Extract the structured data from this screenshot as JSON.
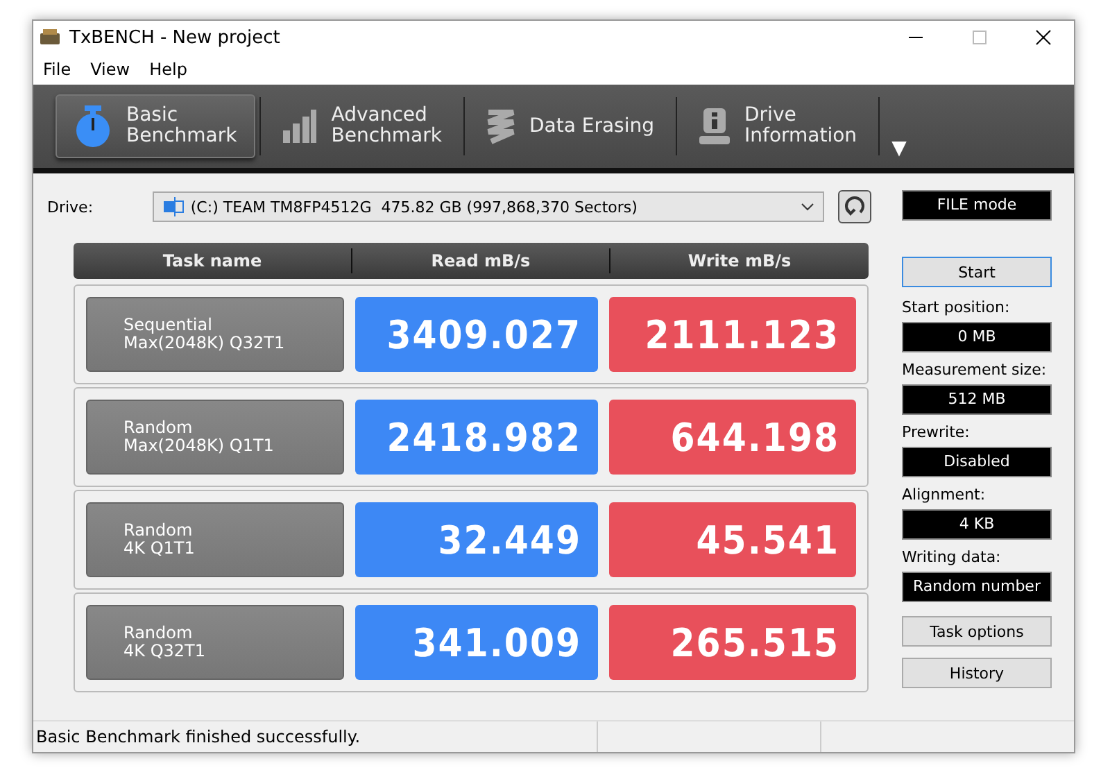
{
  "window": {
    "title": "TxBENCH - New project"
  },
  "menu": [
    "File",
    "View",
    "Help"
  ],
  "tabs": [
    {
      "label": "Basic\nBenchmark",
      "kind": "timer",
      "selected": true
    },
    {
      "label": "Advanced\nBenchmark",
      "kind": "bars",
      "selected": false
    },
    {
      "label": "Data Erasing",
      "kind": "spring",
      "selected": false
    },
    {
      "label": "Drive\nInformation",
      "kind": "info",
      "selected": false
    }
  ],
  "tabs_more": "▼",
  "drive": {
    "label": "Drive:",
    "value": "(C:) TEAM TM8FP4512G  475.82 GB (997,868,370 Sectors)"
  },
  "table": {
    "columns": [
      "Task name",
      "Read mB/s",
      "Write mB/s"
    ],
    "rows": [
      {
        "task": "Sequential\nMax(2048K) Q32T1",
        "read": "3409.027",
        "write": "2111.123"
      },
      {
        "task": "Random\nMax(2048K) Q1T1",
        "read": "2418.982",
        "write": "644.198"
      },
      {
        "task": "Random\n4K Q1T1",
        "read": "32.449",
        "write": "45.541"
      },
      {
        "task": "Random\n4K Q32T1",
        "read": "341.009",
        "write": "265.515"
      }
    ]
  },
  "mode": "FILE mode",
  "start_button": "Start",
  "settings": [
    {
      "label": "Start position:",
      "value": "0 MB"
    },
    {
      "label": "Measurement size:",
      "value": "512 MB"
    },
    {
      "label": "Prewrite:",
      "value": "Disabled"
    },
    {
      "label": "Alignment:",
      "value": "4 KB"
    },
    {
      "label": "Writing data:",
      "value": "Random number"
    }
  ],
  "buttons": [
    "Task options",
    "History"
  ],
  "status_bar": "Basic Benchmark finished successfully."
}
